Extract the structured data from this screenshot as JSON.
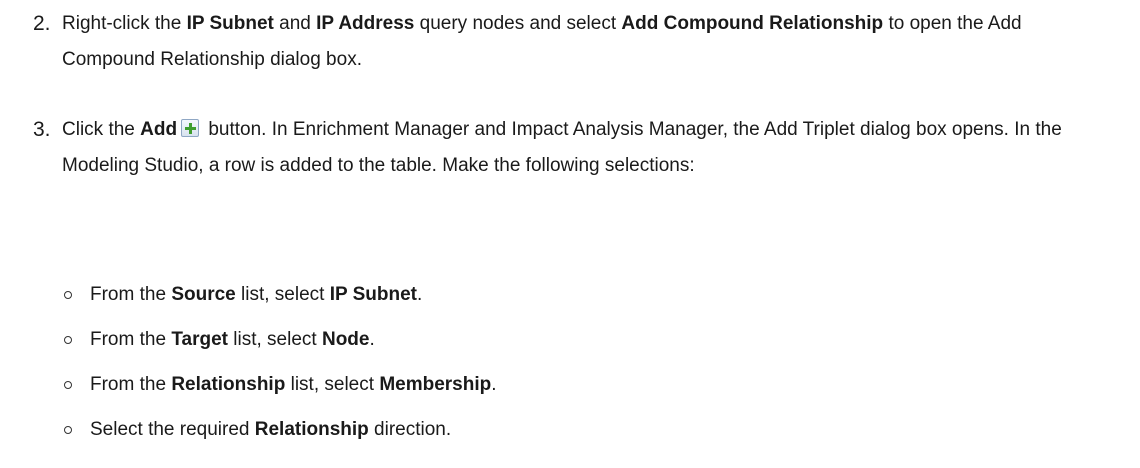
{
  "step2": {
    "number": "2.",
    "t1": "Right-click the ",
    "b1": "IP Subnet",
    "t2": " and ",
    "b2": "IP Address",
    "t3": " query nodes and select ",
    "b3": "Add Compound Relationship",
    "t4": " to open the Add Compound Relationship dialog box."
  },
  "step3": {
    "number": "3.",
    "t1": "Click the ",
    "b1": "Add",
    "icon": "add-plus-icon",
    "t2": " button. In Enrichment Manager and Impact Analysis Manager, the Add Triplet dialog box opens. In the Modeling Studio, a row is added to the table. Make the following selections:"
  },
  "bullets": [
    {
      "t1": "From the ",
      "b1": "Source",
      "t2": " list, select ",
      "b2": "IP Subnet",
      "t3": "."
    },
    {
      "t1": "From the ",
      "b1": "Target",
      "t2": " list, select ",
      "b2": "Node",
      "t3": "."
    },
    {
      "t1": "From the ",
      "b1": "Relationship",
      "t2": " list, select ",
      "b2": "Membership",
      "t3": "."
    },
    {
      "t1": "Select the required ",
      "b1": "Relationship",
      "t2": " direction.",
      "b2": "",
      "t3": ""
    }
  ]
}
